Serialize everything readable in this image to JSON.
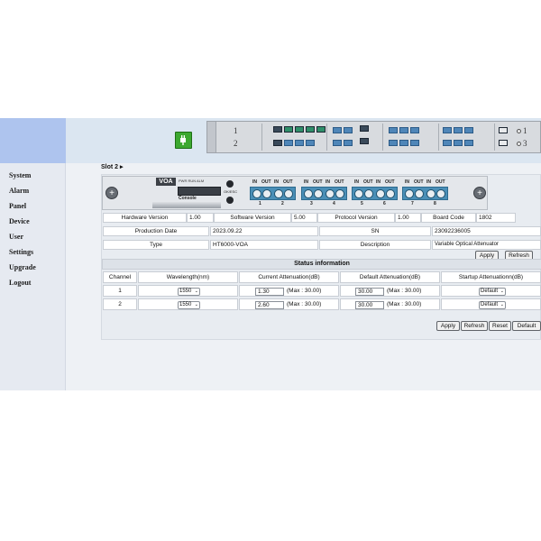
{
  "sidebar": {
    "items": [
      "System",
      "Alarm",
      "Panel",
      "Device",
      "User",
      "Settings",
      "Upgrade",
      "Logout"
    ]
  },
  "header": {
    "power_icon": "power-plug-icon"
  },
  "chassis": {
    "slot_labels": [
      "1",
      "2"
    ],
    "right_labels": [
      "1",
      "3"
    ]
  },
  "slot": {
    "title": "Slot 2 ▸"
  },
  "board": {
    "tag": "VOA",
    "leds": "PWR RUN ALM",
    "console": "Console",
    "okesc": "OK/ESC",
    "port_headers": [
      "IN",
      "OUT",
      "IN",
      "OUT"
    ],
    "port_numbers": [
      "1",
      "2",
      "3",
      "4",
      "5",
      "6",
      "7",
      "8"
    ]
  },
  "info": {
    "hardware_version_label": "Hardware Version",
    "hardware_version": "1.00",
    "software_version_label": "Software Version",
    "software_version": "5.00",
    "protocol_version_label": "Protocol Version",
    "protocol_version": "1.00",
    "board_code_label": "Board Code",
    "board_code": "1802",
    "production_date_label": "Production Date",
    "production_date": "2023.09.22",
    "sn_label": "SN",
    "sn": "23092236005",
    "type_label": "Type",
    "type": "HT6000-VOA",
    "description_label": "Description",
    "description": "Variable Optical Attenuator"
  },
  "info_buttons": {
    "apply": "Apply",
    "refresh": "Refresh"
  },
  "status": {
    "title": "Status information",
    "columns": [
      "Channel",
      "Wavelength(nm)",
      "Current Attenuation(dB)",
      "Default Attenuation(dB)",
      "Startup Attenuationn(dB)"
    ],
    "rows": [
      {
        "channel": "1",
        "wavelength": "1550",
        "current": "1.30",
        "current_max": "(Max : 30.00)",
        "default": "30.00",
        "default_max": "(Max : 30.00)",
        "startup": "Default"
      },
      {
        "channel": "2",
        "wavelength": "1550",
        "current": "2.60",
        "current_max": "(Max : 30.00)",
        "default": "30.00",
        "default_max": "(Max : 30.00)",
        "startup": "Default"
      }
    ]
  },
  "status_buttons": {
    "apply": "Apply",
    "refresh": "Refresh",
    "reset": "Reset",
    "default": "Default"
  }
}
